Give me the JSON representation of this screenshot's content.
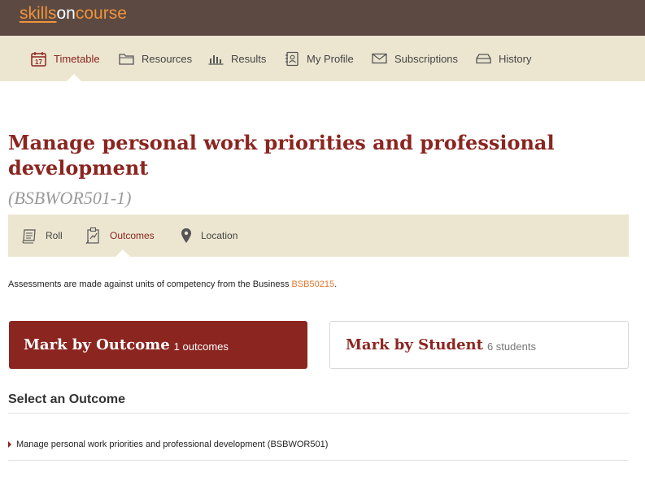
{
  "brand": {
    "part1": "skills",
    "part2": "on",
    "part3": "course"
  },
  "main_nav": {
    "items": [
      {
        "label": "Timetable",
        "icon": "calendar-icon",
        "active": true
      },
      {
        "label": "Resources",
        "icon": "folder-icon"
      },
      {
        "label": "Results",
        "icon": "bar-chart-icon"
      },
      {
        "label": "My Profile",
        "icon": "profile-icon"
      },
      {
        "label": "Subscriptions",
        "icon": "envelope-icon"
      },
      {
        "label": "History",
        "icon": "archive-icon"
      }
    ],
    "calendar_day": "17"
  },
  "page": {
    "title": "Manage personal work priorities and professional development",
    "code": "(BSBWOR501-1)"
  },
  "sub_nav": {
    "items": [
      {
        "label": "Roll",
        "icon": "roll-icon"
      },
      {
        "label": "Outcomes",
        "icon": "outcomes-icon",
        "active": true
      },
      {
        "label": "Location",
        "icon": "map-pin-icon"
      }
    ]
  },
  "info": {
    "text": "Assessments are made against units of competency from the Business ",
    "link": "BSB50215",
    "suffix": "."
  },
  "mark": {
    "outcome": {
      "label": "Mark by Outcome",
      "count": "1 outcomes"
    },
    "student": {
      "label": "Mark by Student",
      "count": "6 students"
    }
  },
  "outcomes": {
    "heading": "Select an Outcome",
    "items": [
      {
        "label": "Manage personal work priorities and professional development (BSBWOR501)"
      }
    ]
  },
  "colors": {
    "brand_bar": "#5c4a42",
    "nav_bg": "#ece6d1",
    "accent": "#8b2520",
    "link": "#e0762b"
  }
}
